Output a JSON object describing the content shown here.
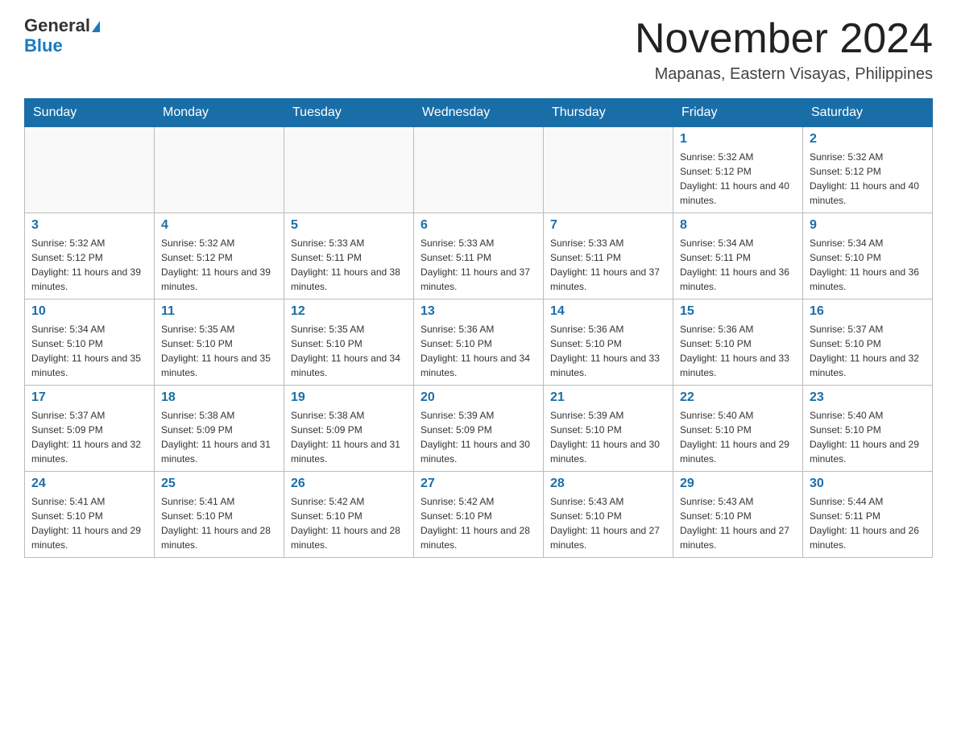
{
  "header": {
    "logo_line1": "General",
    "logo_line2": "Blue",
    "month_title": "November 2024",
    "location": "Mapanas, Eastern Visayas, Philippines"
  },
  "calendar": {
    "days_of_week": [
      "Sunday",
      "Monday",
      "Tuesday",
      "Wednesday",
      "Thursday",
      "Friday",
      "Saturday"
    ],
    "weeks": [
      [
        {
          "day": "",
          "info": ""
        },
        {
          "day": "",
          "info": ""
        },
        {
          "day": "",
          "info": ""
        },
        {
          "day": "",
          "info": ""
        },
        {
          "day": "",
          "info": ""
        },
        {
          "day": "1",
          "info": "Sunrise: 5:32 AM\nSunset: 5:12 PM\nDaylight: 11 hours and 40 minutes."
        },
        {
          "day": "2",
          "info": "Sunrise: 5:32 AM\nSunset: 5:12 PM\nDaylight: 11 hours and 40 minutes."
        }
      ],
      [
        {
          "day": "3",
          "info": "Sunrise: 5:32 AM\nSunset: 5:12 PM\nDaylight: 11 hours and 39 minutes."
        },
        {
          "day": "4",
          "info": "Sunrise: 5:32 AM\nSunset: 5:12 PM\nDaylight: 11 hours and 39 minutes."
        },
        {
          "day": "5",
          "info": "Sunrise: 5:33 AM\nSunset: 5:11 PM\nDaylight: 11 hours and 38 minutes."
        },
        {
          "day": "6",
          "info": "Sunrise: 5:33 AM\nSunset: 5:11 PM\nDaylight: 11 hours and 37 minutes."
        },
        {
          "day": "7",
          "info": "Sunrise: 5:33 AM\nSunset: 5:11 PM\nDaylight: 11 hours and 37 minutes."
        },
        {
          "day": "8",
          "info": "Sunrise: 5:34 AM\nSunset: 5:11 PM\nDaylight: 11 hours and 36 minutes."
        },
        {
          "day": "9",
          "info": "Sunrise: 5:34 AM\nSunset: 5:10 PM\nDaylight: 11 hours and 36 minutes."
        }
      ],
      [
        {
          "day": "10",
          "info": "Sunrise: 5:34 AM\nSunset: 5:10 PM\nDaylight: 11 hours and 35 minutes."
        },
        {
          "day": "11",
          "info": "Sunrise: 5:35 AM\nSunset: 5:10 PM\nDaylight: 11 hours and 35 minutes."
        },
        {
          "day": "12",
          "info": "Sunrise: 5:35 AM\nSunset: 5:10 PM\nDaylight: 11 hours and 34 minutes."
        },
        {
          "day": "13",
          "info": "Sunrise: 5:36 AM\nSunset: 5:10 PM\nDaylight: 11 hours and 34 minutes."
        },
        {
          "day": "14",
          "info": "Sunrise: 5:36 AM\nSunset: 5:10 PM\nDaylight: 11 hours and 33 minutes."
        },
        {
          "day": "15",
          "info": "Sunrise: 5:36 AM\nSunset: 5:10 PM\nDaylight: 11 hours and 33 minutes."
        },
        {
          "day": "16",
          "info": "Sunrise: 5:37 AM\nSunset: 5:10 PM\nDaylight: 11 hours and 32 minutes."
        }
      ],
      [
        {
          "day": "17",
          "info": "Sunrise: 5:37 AM\nSunset: 5:09 PM\nDaylight: 11 hours and 32 minutes."
        },
        {
          "day": "18",
          "info": "Sunrise: 5:38 AM\nSunset: 5:09 PM\nDaylight: 11 hours and 31 minutes."
        },
        {
          "day": "19",
          "info": "Sunrise: 5:38 AM\nSunset: 5:09 PM\nDaylight: 11 hours and 31 minutes."
        },
        {
          "day": "20",
          "info": "Sunrise: 5:39 AM\nSunset: 5:09 PM\nDaylight: 11 hours and 30 minutes."
        },
        {
          "day": "21",
          "info": "Sunrise: 5:39 AM\nSunset: 5:10 PM\nDaylight: 11 hours and 30 minutes."
        },
        {
          "day": "22",
          "info": "Sunrise: 5:40 AM\nSunset: 5:10 PM\nDaylight: 11 hours and 29 minutes."
        },
        {
          "day": "23",
          "info": "Sunrise: 5:40 AM\nSunset: 5:10 PM\nDaylight: 11 hours and 29 minutes."
        }
      ],
      [
        {
          "day": "24",
          "info": "Sunrise: 5:41 AM\nSunset: 5:10 PM\nDaylight: 11 hours and 29 minutes."
        },
        {
          "day": "25",
          "info": "Sunrise: 5:41 AM\nSunset: 5:10 PM\nDaylight: 11 hours and 28 minutes."
        },
        {
          "day": "26",
          "info": "Sunrise: 5:42 AM\nSunset: 5:10 PM\nDaylight: 11 hours and 28 minutes."
        },
        {
          "day": "27",
          "info": "Sunrise: 5:42 AM\nSunset: 5:10 PM\nDaylight: 11 hours and 28 minutes."
        },
        {
          "day": "28",
          "info": "Sunrise: 5:43 AM\nSunset: 5:10 PM\nDaylight: 11 hours and 27 minutes."
        },
        {
          "day": "29",
          "info": "Sunrise: 5:43 AM\nSunset: 5:10 PM\nDaylight: 11 hours and 27 minutes."
        },
        {
          "day": "30",
          "info": "Sunrise: 5:44 AM\nSunset: 5:11 PM\nDaylight: 11 hours and 26 minutes."
        }
      ]
    ]
  }
}
